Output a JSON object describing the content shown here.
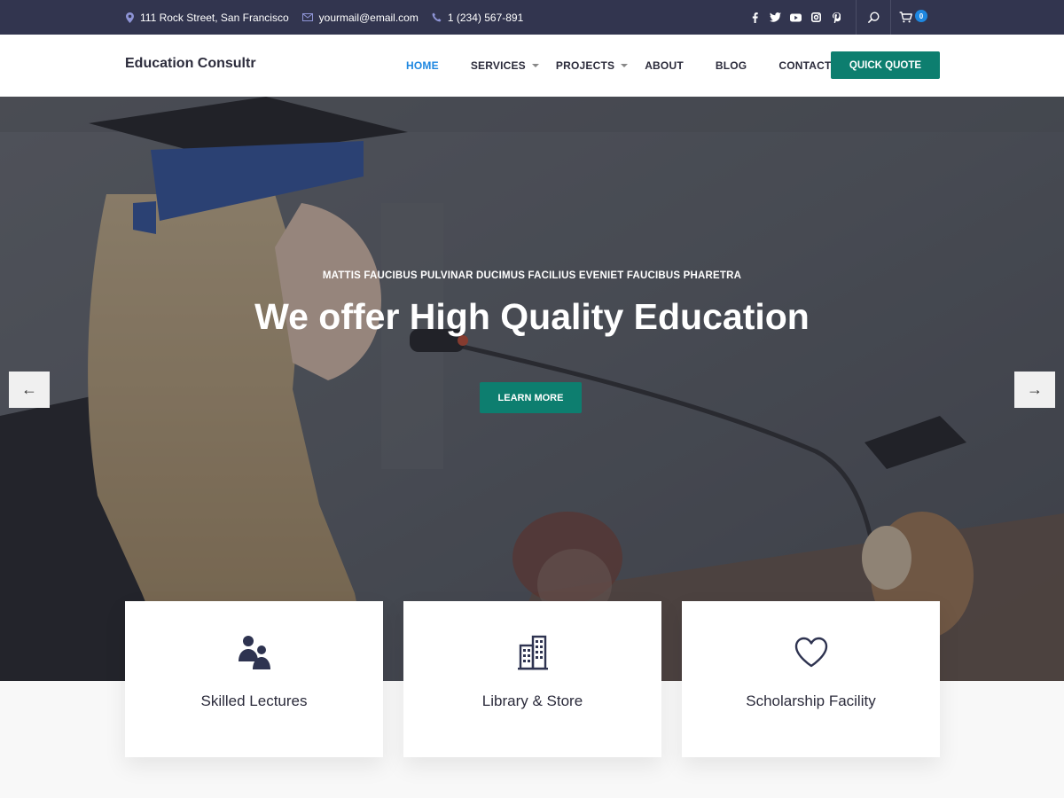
{
  "topbar": {
    "address": "111 Rock Street, San Francisco",
    "email": "yourmail@email.com",
    "phone": "1 (234) 567-891",
    "social_icons": [
      "facebook-icon",
      "twitter-icon",
      "youtube-icon",
      "instagram-icon",
      "pinterest-icon"
    ],
    "cart_count": "0"
  },
  "header": {
    "logo": "Education Consultr",
    "nav": [
      {
        "label": "HOME",
        "active": true
      },
      {
        "label": "SERVICES",
        "dropdown": true
      },
      {
        "label": "PROJECTS",
        "dropdown": true
      },
      {
        "label": "ABOUT"
      },
      {
        "label": "BLOG"
      },
      {
        "label": "CONTACT"
      }
    ],
    "quote_button": "QUICK QUOTE"
  },
  "hero": {
    "subtitle": "MATTIS FAUCIBUS PULVINAR DUCIMUS FACILIUS EVENIET FAUCIBUS PHARETRA",
    "title": "We offer High Quality Education",
    "button": "LEARN MORE",
    "prev_arrow": "←",
    "next_arrow": "→"
  },
  "features": [
    {
      "label": "Skilled Lectures",
      "icon": "people-icon"
    },
    {
      "label": "Library & Store",
      "icon": "building-icon"
    },
    {
      "label": "Scholarship Facility",
      "icon": "heart-icon"
    }
  ],
  "colors": {
    "topbar_bg": "#32354f",
    "accent_teal": "#0d7e6f",
    "nav_active": "#1e87e0"
  }
}
